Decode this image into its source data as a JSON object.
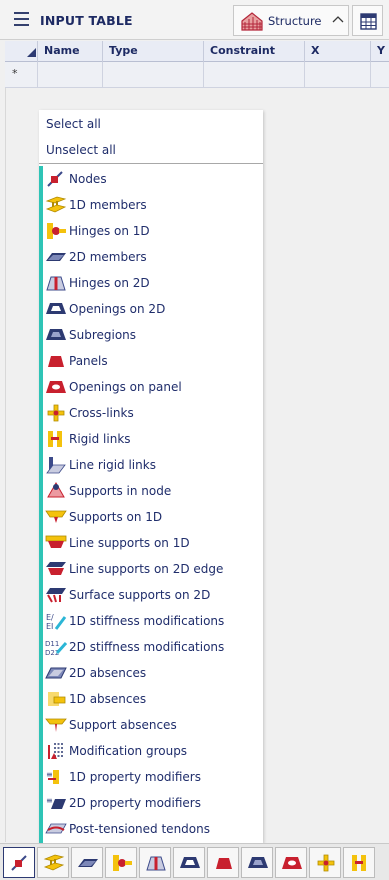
{
  "panel": {
    "title": "INPUT TABLE",
    "structure_label": "Structure"
  },
  "grid": {
    "columns": [
      "Name",
      "Type",
      "Constraint",
      "X",
      "Y"
    ],
    "new_row_marker": "*"
  },
  "menu": {
    "select_all": "Select all",
    "unselect_all": "Unselect all",
    "items": [
      {
        "label": "Nodes",
        "icon": "node-icon"
      },
      {
        "label": "1D members",
        "icon": "beam-icon"
      },
      {
        "label": "Hinges on 1D",
        "icon": "hinge-1d-icon"
      },
      {
        "label": "2D members",
        "icon": "plate-icon"
      },
      {
        "label": "Hinges on 2D",
        "icon": "hinge-2d-icon"
      },
      {
        "label": "Openings on 2D",
        "icon": "opening-2d-icon"
      },
      {
        "label": "Subregions",
        "icon": "subregion-icon"
      },
      {
        "label": "Panels",
        "icon": "panel-icon"
      },
      {
        "label": "Openings on panel",
        "icon": "opening-panel-icon"
      },
      {
        "label": "Cross-links",
        "icon": "cross-link-icon"
      },
      {
        "label": "Rigid links",
        "icon": "rigid-link-icon"
      },
      {
        "label": "Line rigid links",
        "icon": "line-rigid-link-icon"
      },
      {
        "label": "Supports in node",
        "icon": "node-support-icon"
      },
      {
        "label": "Supports on 1D",
        "icon": "support-1d-icon"
      },
      {
        "label": "Line supports on 1D",
        "icon": "line-support-1d-icon"
      },
      {
        "label": "Line supports on 2D edge",
        "icon": "line-support-2d-edge-icon"
      },
      {
        "label": "Surface supports on 2D",
        "icon": "surface-support-icon"
      },
      {
        "label": "1D stiffness modifications",
        "icon": "stiffness-1d-icon"
      },
      {
        "label": "2D stiffness modifications",
        "icon": "stiffness-2d-icon"
      },
      {
        "label": "2D absences",
        "icon": "absence-2d-icon"
      },
      {
        "label": "1D absences",
        "icon": "absence-1d-icon"
      },
      {
        "label": "Support absences",
        "icon": "support-absence-icon"
      },
      {
        "label": "Modification groups",
        "icon": "modification-group-icon"
      },
      {
        "label": "1D property modifiers",
        "icon": "property-modifier-1d-icon"
      },
      {
        "label": "2D property modifiers",
        "icon": "property-modifier-2d-icon"
      },
      {
        "label": "Post-tensioned tendons",
        "icon": "tendon-icon"
      }
    ]
  },
  "statusbar": {
    "tabs": [
      "node-icon",
      "beam-icon",
      "plate-icon",
      "hinge-1d-icon",
      "hinge-2d-icon",
      "opening-2d-icon",
      "panel-icon",
      "subregion-icon",
      "opening-panel-icon",
      "cross-link-icon",
      "rigid-link-icon"
    ],
    "active_index": 0
  },
  "colors": {
    "text": "#1f2d6b",
    "accent": "#2ec4b6",
    "icon_yellow": "#f4c20d",
    "icon_red": "#c8202e",
    "icon_blue": "#3c4a8a"
  }
}
